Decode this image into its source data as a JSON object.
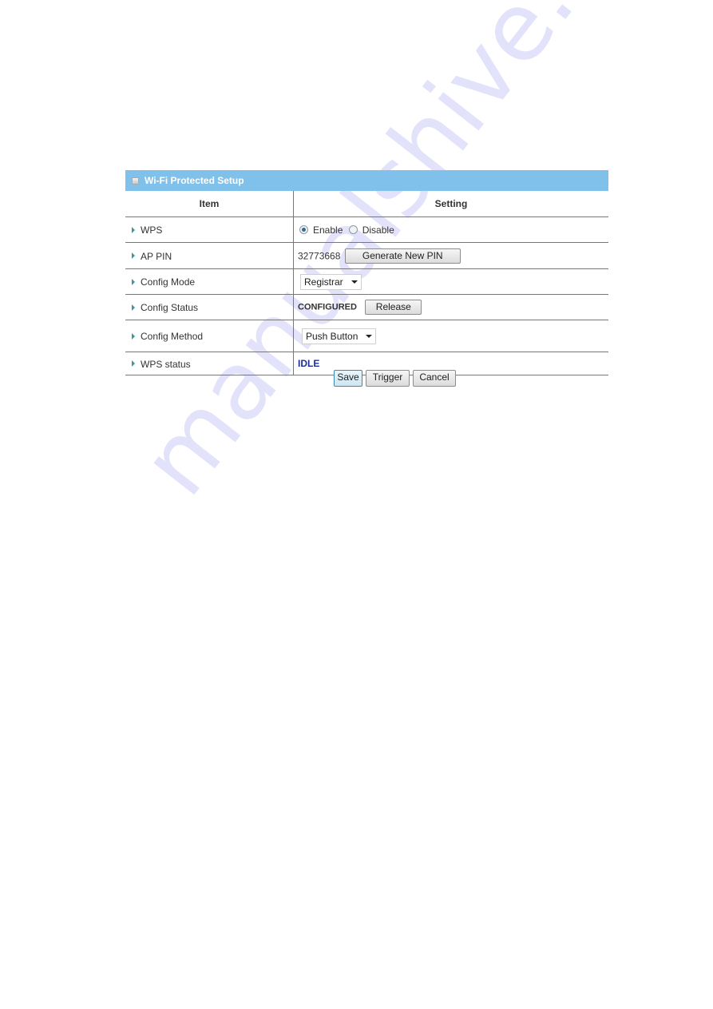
{
  "panel": {
    "title": "Wi-Fi Protected Setup",
    "header_icon": "window-icon"
  },
  "table": {
    "columns": [
      "Item",
      "Setting"
    ],
    "rows": [
      {
        "label": "WPS"
      },
      {
        "label": "AP PIN"
      },
      {
        "label": "Config Mode"
      },
      {
        "label": "Config Status"
      },
      {
        "label": "Config Method"
      },
      {
        "label": "WPS status"
      }
    ]
  },
  "wps": {
    "options": [
      "Enable",
      "Disable"
    ],
    "selected": "Enable"
  },
  "ap_pin": {
    "value": "32773668",
    "generate_label": "Generate New PIN"
  },
  "config_mode": {
    "selected": "Registrar"
  },
  "config_status": {
    "value": "CONFIGURED",
    "release_label": "Release"
  },
  "config_method": {
    "selected": "Push Button"
  },
  "wps_status": {
    "value": "IDLE",
    "color": "#1c2f9a"
  },
  "actions": {
    "save": "Save",
    "trigger": "Trigger",
    "cancel": "Cancel"
  },
  "watermark": "manualshive.com",
  "colors": {
    "header_bg": "#7fc1ea",
    "arrow": "#3a9a9a"
  }
}
